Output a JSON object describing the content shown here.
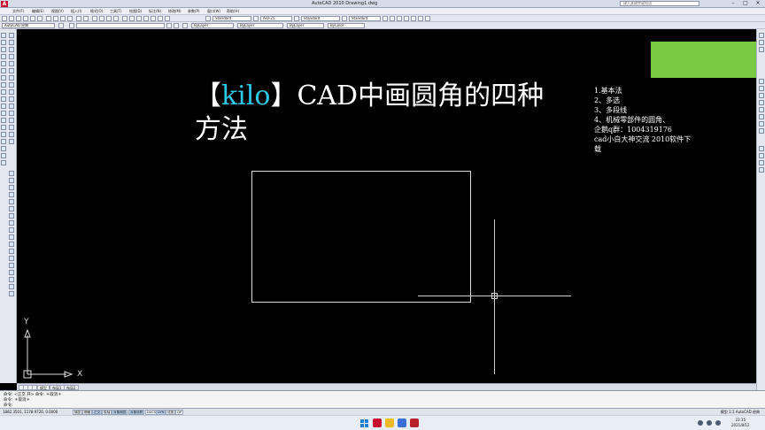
{
  "titlebar": {
    "title": "AutoCAD 2010    Drawing1.dwg",
    "search_placeholder": "键入关键字或短语",
    "minimize": "–",
    "maximize": "□",
    "close": "✕"
  },
  "menubar": {
    "items": [
      "文件(F)",
      "编辑(E)",
      "视图(V)",
      "插入(I)",
      "格式(O)",
      "工具(T)",
      "绘图(D)",
      "标注(N)",
      "修改(M)",
      "参数(P)",
      "窗口(W)",
      "帮助(H)"
    ]
  },
  "toolbar": {
    "text_style": "Standard",
    "dim_style": "ISO-25",
    "table_style": "Standard",
    "multileader_style": "Standard",
    "workspace": "AutoCAD 经典",
    "color": "ByLayer",
    "linetype": "ByLayer",
    "lineweight": "ByLayer",
    "plotstyle": "ByColor"
  },
  "drawing": {
    "title_bracket_open": "【",
    "title_keyword": "kilo",
    "title_bracket_close": "】",
    "title_rest": "CAD中画圆角的四种方法",
    "notes": [
      "1.基本法",
      "2、多选",
      "3、多段线",
      "4、机械零部件的圆角、",
      "企鹅q群：1004319176",
      "cad小白大神交流 2010软件下",
      "载"
    ],
    "ucs_y": "Y",
    "ucs_x": "X",
    "colors": {
      "background": "#000000",
      "accent_block": "#7ac943",
      "keyword": "#2ec8e8",
      "text": "#ffffff"
    }
  },
  "tabs": {
    "items": [
      "模型",
      "布局1",
      "布局2"
    ]
  },
  "command": {
    "lines": [
      "命令: <正交 开> 命令: ＊取消＊",
      "命令: ＊取消＊",
      "命令:"
    ]
  },
  "status": {
    "coords": "1882.3501, 1178.9720, 0.0000",
    "buttons": [
      "捕捉",
      "栅格",
      "正交",
      "极轴",
      "对象捕捉",
      "对象追踪",
      "DUCS",
      "DYN",
      "线宽",
      "QP"
    ],
    "model_label": "模型",
    "scale": "1:1",
    "workspace": "AutoCAD 经典"
  },
  "taskbar": {
    "time": "23:15",
    "date": "2021/8/12"
  }
}
